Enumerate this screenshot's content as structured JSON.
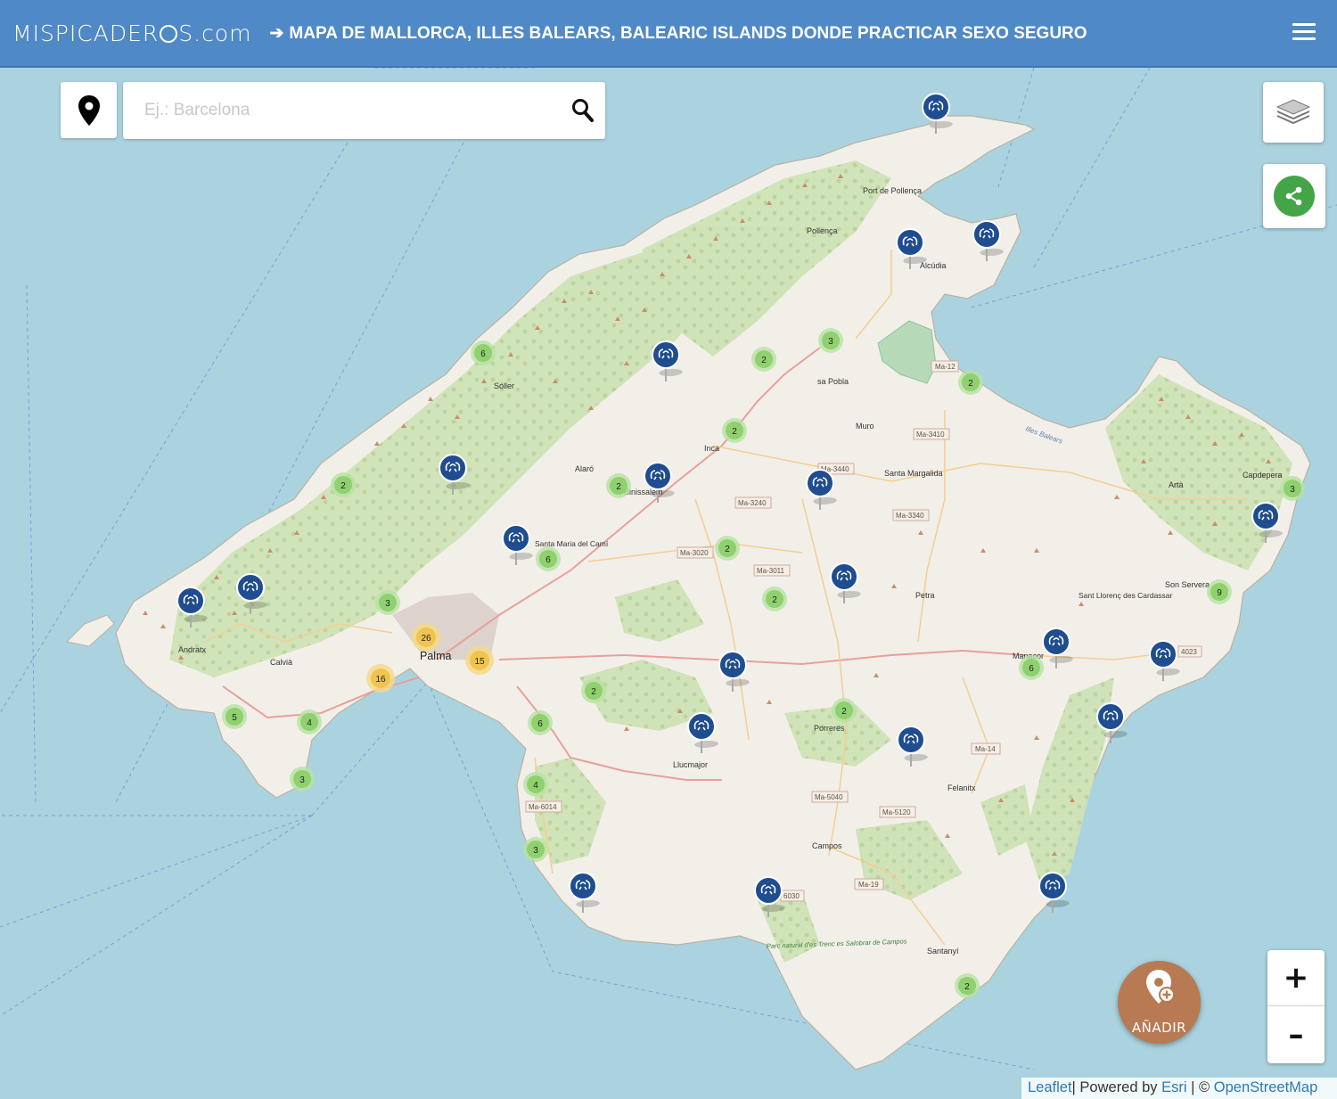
{
  "header": {
    "logo_left": "MISPICADER",
    "logo_right": "S.com",
    "arrow": "➔",
    "title": "MAPA DE MALLORCA, ILLES BALEARS, BALEARIC ISLANDS DONDE PRACTICAR SEXO SEGURO"
  },
  "search": {
    "placeholder": "Ej.: Barcelona"
  },
  "add_button": {
    "label": "AÑADIR"
  },
  "zoom": {
    "in": "+",
    "out": "–"
  },
  "attribution": {
    "leaflet": "Leaflet",
    "powered": "| Powered by ",
    "esri": "Esri",
    "sep": " | © ",
    "osm": "OpenStreetMap"
  },
  "colors": {
    "header": "#4f89c6",
    "sea": "#aad3df",
    "land": "#f2efe9",
    "forest": "#c8dcb0",
    "cluster_small": "#8fd06f",
    "cluster_large": "#f0c44f",
    "marker": "#1f4d8f",
    "share": "#43a548",
    "add": "#b87a52"
  },
  "places": [
    {
      "name": "Port de Pollença"
    },
    {
      "name": "Pollença"
    },
    {
      "name": "Alcúdia"
    },
    {
      "name": "Sóller"
    },
    {
      "name": "sa Pobla"
    },
    {
      "name": "Muro"
    },
    {
      "name": "Inca"
    },
    {
      "name": "Alaró"
    },
    {
      "name": "Binissalem"
    },
    {
      "name": "Santa Margalida"
    },
    {
      "name": "Santa Maria del Camí"
    },
    {
      "name": "Capdepera"
    },
    {
      "name": "Artà"
    },
    {
      "name": "Son Servera"
    },
    {
      "name": "Sant Llorenç des Cardassar"
    },
    {
      "name": "Petra"
    },
    {
      "name": "Andratx"
    },
    {
      "name": "Calvià"
    },
    {
      "name": "Palma"
    },
    {
      "name": "Manacor"
    },
    {
      "name": "Porreres"
    },
    {
      "name": "Llucmajor"
    },
    {
      "name": "Felanitx"
    },
    {
      "name": "Campos"
    },
    {
      "name": "Santanyí"
    },
    {
      "name": "Parc natural d'es Trenc es Salobrar de Campos"
    }
  ],
  "roads": [
    {
      "name": "Ma-12"
    },
    {
      "name": "Ma-3410"
    },
    {
      "name": "Ma-3440"
    },
    {
      "name": "Ma-3240"
    },
    {
      "name": "Ma-3340"
    },
    {
      "name": "Ma-3020"
    },
    {
      "name": "Ma-3011"
    },
    {
      "name": "Ma-6014"
    },
    {
      "name": "Ma-5040"
    },
    {
      "name": "Ma-5120"
    },
    {
      "name": "Ma-14"
    },
    {
      "name": "Ma-19"
    },
    {
      "name": "4023"
    },
    {
      "name": "6030"
    }
  ],
  "coast_label": "Illes Balears",
  "clusters": [
    {
      "count": "6"
    },
    {
      "count": "3"
    },
    {
      "count": "2"
    },
    {
      "count": "2"
    },
    {
      "count": "2"
    },
    {
      "count": "2"
    },
    {
      "count": "2"
    },
    {
      "count": "6"
    },
    {
      "count": "2"
    },
    {
      "count": "3"
    },
    {
      "count": "2"
    },
    {
      "count": "9"
    },
    {
      "count": "3"
    },
    {
      "count": "26"
    },
    {
      "count": "15"
    },
    {
      "count": "16"
    },
    {
      "count": "2"
    },
    {
      "count": "5"
    },
    {
      "count": "4"
    },
    {
      "count": "6"
    },
    {
      "count": "3"
    },
    {
      "count": "2"
    },
    {
      "count": "6"
    },
    {
      "count": "4"
    },
    {
      "count": "3"
    },
    {
      "count": "2"
    }
  ],
  "markers_count": 19
}
